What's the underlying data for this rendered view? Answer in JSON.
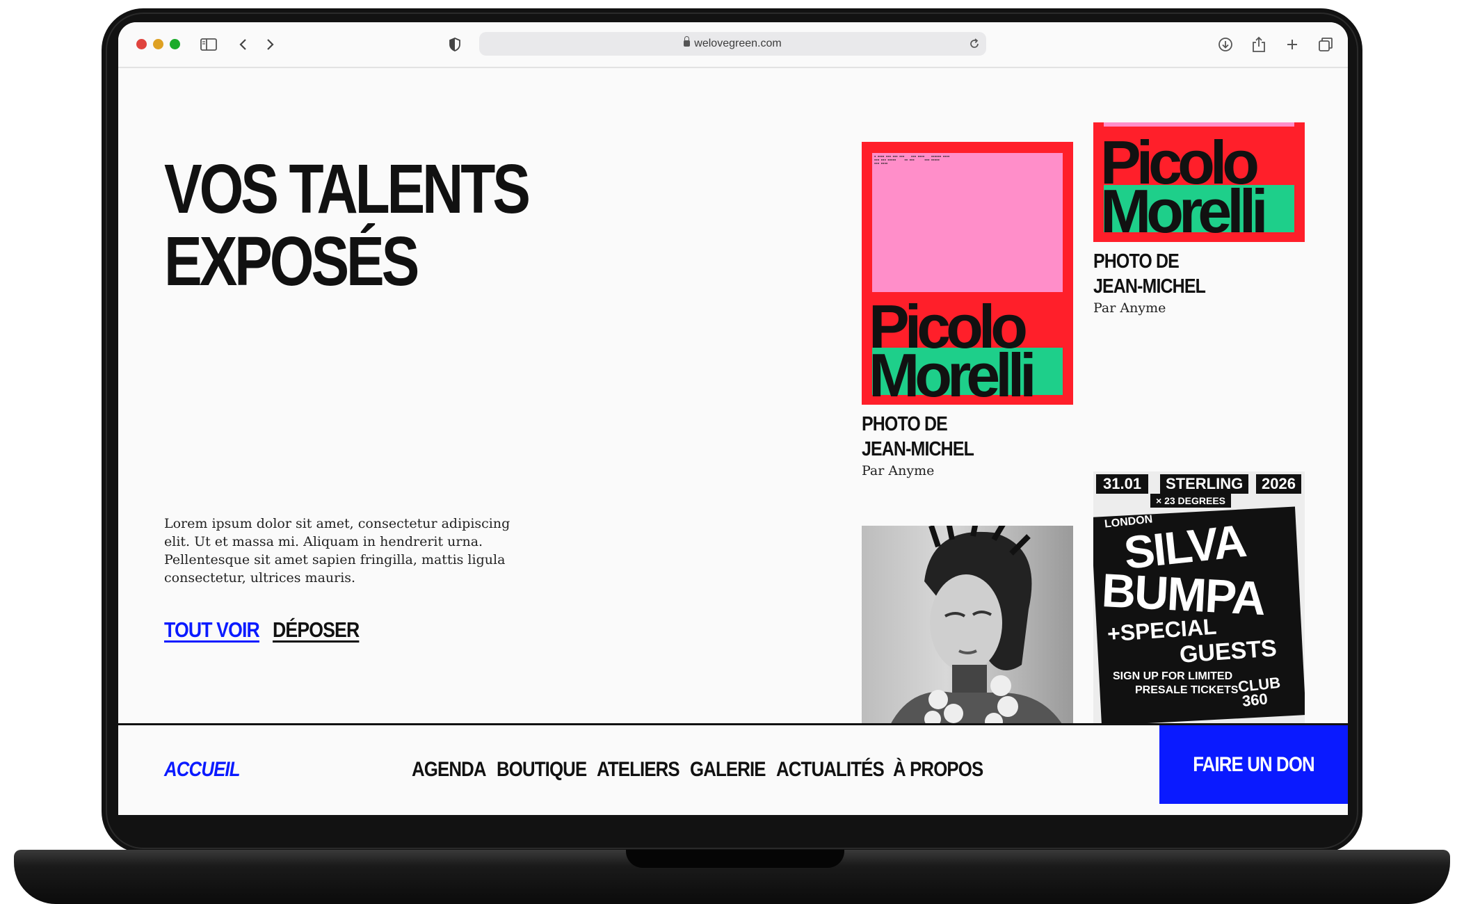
{
  "browser": {
    "url": "welovegreen.com",
    "traffic_lights": [
      "#e0443e",
      "#dea123",
      "#1aab29"
    ]
  },
  "hero": {
    "title_line1": "VOS TALENTS",
    "title_line2": "EXPOSÉS",
    "intro": "Lorem ipsum dolor sit amet, consectetur adipiscing elit. Ut et massa mi. Aliquam in hendrerit urna. Pellentesque sit amet sapien fringilla, mattis ligula consectetur, ultrices mauris.",
    "link_all": "TOUT VOIR",
    "link_submit": "DÉPOSER"
  },
  "gallery": {
    "cards": [
      {
        "title_line1": "PHOTO DE",
        "title_line2": "JEAN-MICHEL",
        "author": "Par Anyme",
        "poster_line1": "Picolo",
        "poster_line2": "Morelli"
      },
      {
        "title_line1": "PHOTO DE",
        "title_line2": "JEAN-MICHEL",
        "author": "Par Anyme",
        "poster_line1": "Picolo",
        "poster_line2": "Morelli"
      }
    ],
    "event_poster": {
      "date": "31.01",
      "venue": "STERLING",
      "year": "2026",
      "collab": "× 23 DEGREES",
      "city": "LONDON",
      "headline1": "SILVA",
      "headline2": "BUMPA",
      "sub1": "+SPECIAL",
      "sub2": "GUESTS",
      "signup1": "SIGN UP FOR LIMITED",
      "signup2": "PRESALE TICKETS",
      "club1": "CLUB",
      "club2": "360"
    }
  },
  "nav": {
    "home": "ACCUEIL",
    "items": [
      "AGENDA",
      "BOUTIQUE",
      "ATELIERS",
      "GALERIE",
      "ACTUALITÉS",
      "À PROPOS"
    ],
    "donate": "FAIRE UN DON"
  },
  "colors": {
    "accent_blue": "#0a1aff",
    "poster_red": "#ff1f2a",
    "poster_pink": "#ff8ec9",
    "poster_green": "#1ecf8a"
  }
}
